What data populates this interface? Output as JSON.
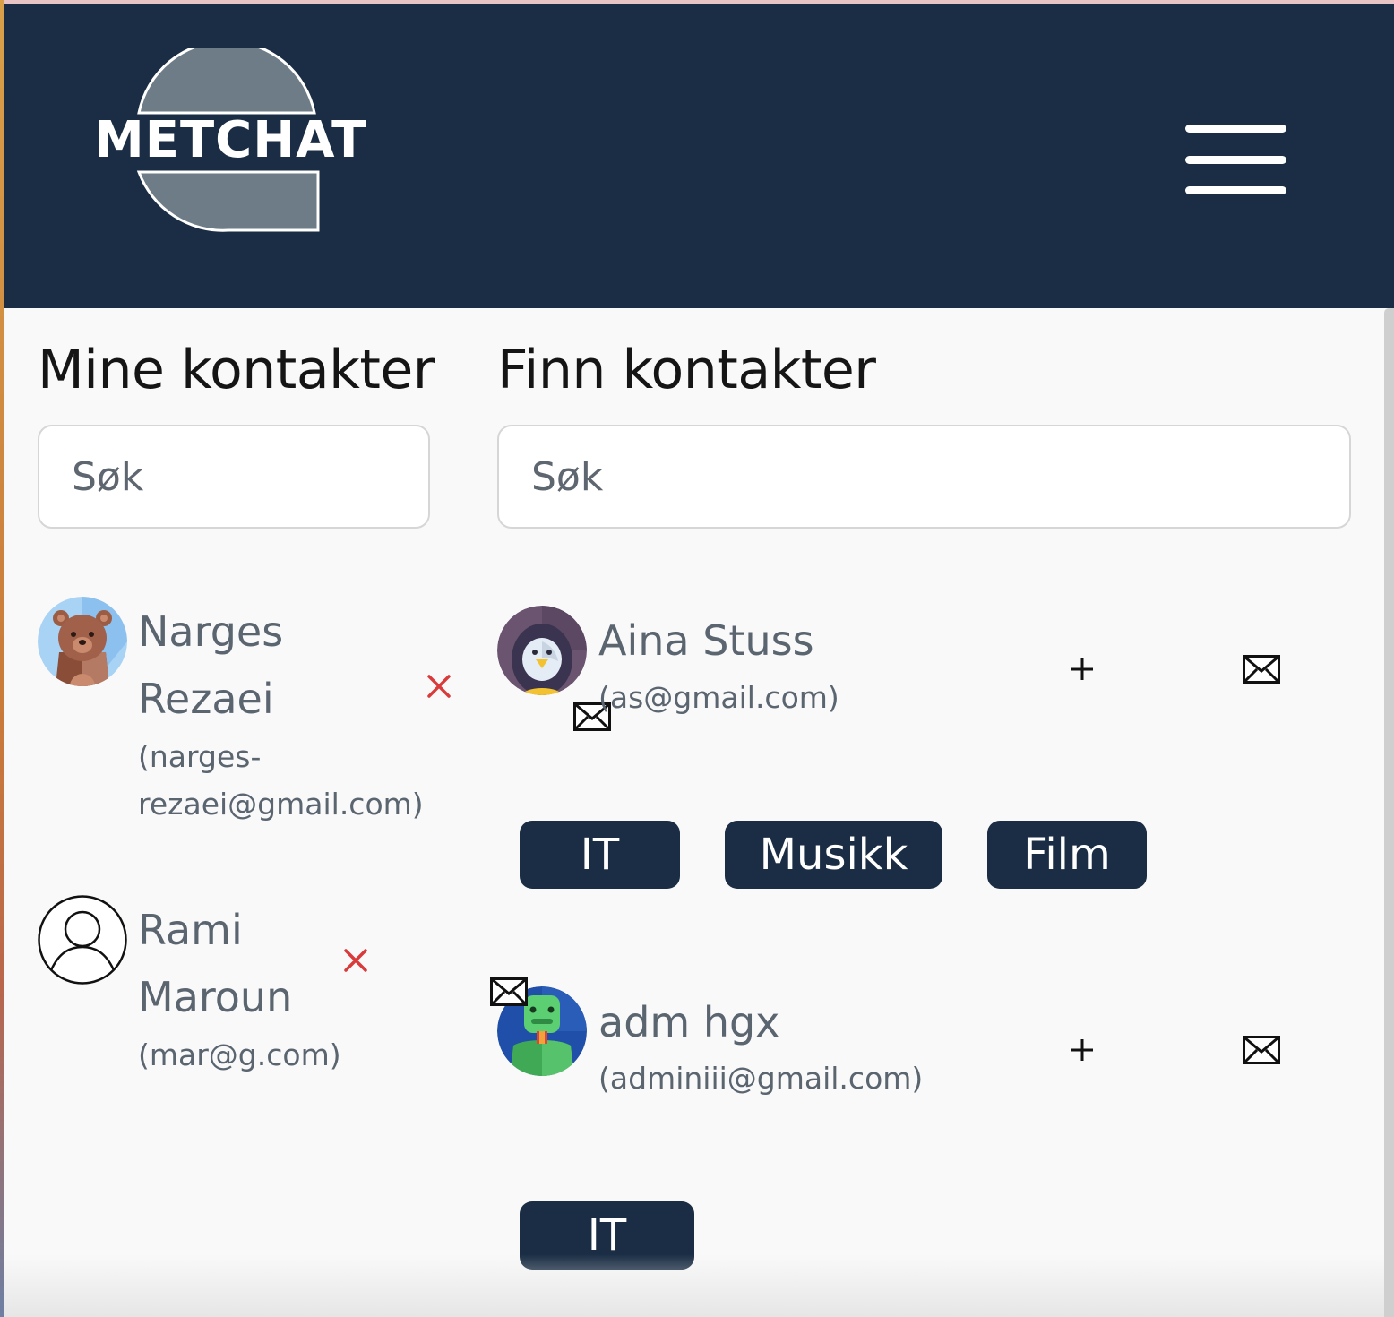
{
  "app": {
    "logo_text": "METCHAT"
  },
  "colors": {
    "header_bg": "#1a2d44",
    "tag_bg": "#1a2d44",
    "remove": "#d93a3a",
    "text_muted": "#5a6570"
  },
  "my_contacts": {
    "title": "Mine kontakter",
    "search_placeholder": "Søk",
    "items": [
      {
        "name_line1": "Narges",
        "name_line2": "Rezaei",
        "email_line1": "(narges-",
        "email_line2": "rezaei@gmail.com)",
        "avatar": "bear-avatar",
        "action_icon": "close-icon"
      },
      {
        "name_line1": "Rami",
        "name_line2": "Maroun",
        "email_line1": "(mar@g.com)",
        "avatar": "user-outline-avatar",
        "action_icon": "close-icon"
      }
    ]
  },
  "find_contacts": {
    "title": "Finn kontakter",
    "search_placeholder": "Søk",
    "items": [
      {
        "name": "Aina Stuss",
        "email": "(as@gmail.com)",
        "avatar": "penguin-avatar",
        "tags": [
          "IT",
          "Musikk",
          "Film"
        ],
        "action_icons": [
          "plus-icon",
          "envelope-icon"
        ]
      },
      {
        "name": "adm hgx",
        "email": "(adminiii@gmail.com)",
        "avatar": "turtle-avatar",
        "tags": [
          "IT"
        ],
        "action_icons": [
          "plus-icon",
          "envelope-icon"
        ]
      }
    ]
  }
}
